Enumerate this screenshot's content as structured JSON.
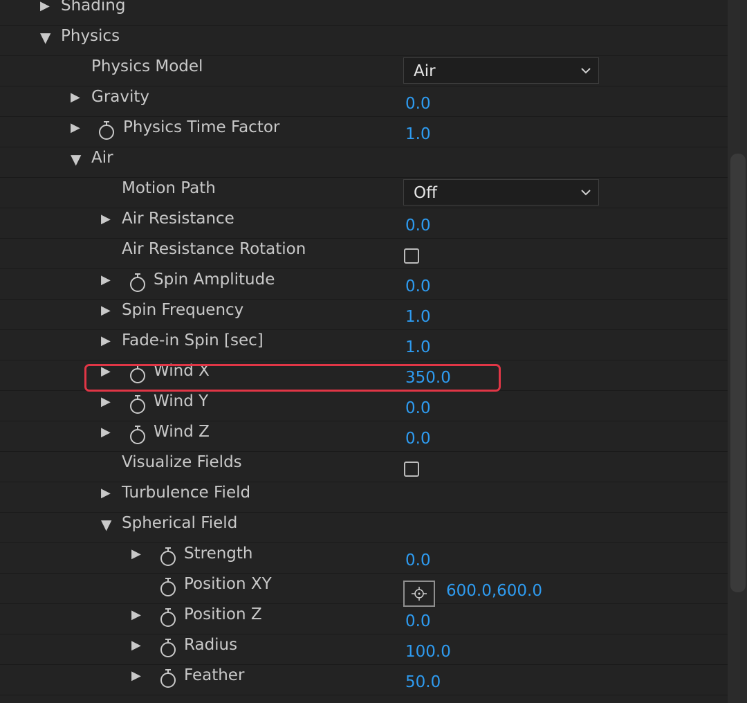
{
  "rows": [
    {
      "label": "Shading"
    },
    {
      "label": "Physics"
    },
    {
      "label": "Physics Model",
      "value": "Air"
    },
    {
      "label": "Gravity",
      "value": "0.0"
    },
    {
      "label": "Physics Time Factor",
      "value": "1.0"
    },
    {
      "label": "Air"
    },
    {
      "label": "Motion Path",
      "value": "Off"
    },
    {
      "label": "Air Resistance",
      "value": "0.0"
    },
    {
      "label": "Air Resistance Rotation",
      "checked": false
    },
    {
      "label": "Spin Amplitude",
      "value": "0.0"
    },
    {
      "label": "Spin Frequency",
      "value": "1.0"
    },
    {
      "label": "Fade-in Spin [sec]",
      "value": "1.0"
    },
    {
      "label": "Wind X",
      "value": "350.0"
    },
    {
      "label": "Wind Y",
      "value": "0.0"
    },
    {
      "label": "Wind Z",
      "value": "0.0"
    },
    {
      "label": "Visualize Fields",
      "checked": false
    },
    {
      "label": "Turbulence Field"
    },
    {
      "label": "Spherical Field"
    },
    {
      "label": "Strength",
      "value": "0.0"
    },
    {
      "label": "Position XY",
      "value": "600.0,600.0"
    },
    {
      "label": "Position Z",
      "value": "0.0"
    },
    {
      "label": "Radius",
      "value": "100.0"
    },
    {
      "label": "Feather",
      "value": "50.0"
    }
  ],
  "colors": {
    "value": "#2e9bf0",
    "highlight": "#e03646",
    "background": "#232323",
    "label": "#c9c9c9"
  }
}
